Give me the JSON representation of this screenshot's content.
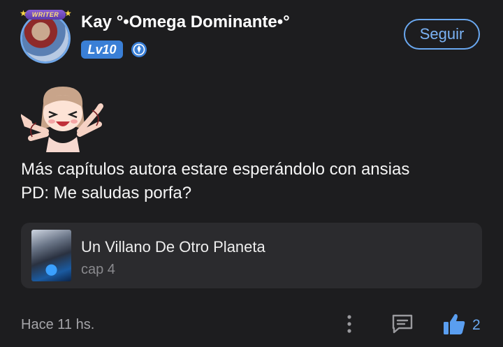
{
  "header": {
    "avatar_badge": "WRITER",
    "username": "Kay °•Omega Dominante•°",
    "level": "Lv10",
    "follow_label": "Seguir"
  },
  "comment": {
    "lines": [
      "Más capítulos autora estare esperándolo con ansias",
      "PD: Me saludas porfa?"
    ]
  },
  "chapter_card": {
    "work_title": "Un Villano De Otro Planeta",
    "chapter": "cap 4"
  },
  "footer": {
    "timestamp": "Hace 11 hs.",
    "likes": "2"
  },
  "icons": {
    "verified": "verified-badge-icon",
    "more": "more-vertical-icon",
    "comment": "comment-bubble-icon",
    "like": "thumbs-up-icon"
  },
  "colors": {
    "background": "#1d1d1f",
    "accent": "#6aa8f0",
    "level_badge": "#3a7fd6",
    "card": "#2b2b2e",
    "muted_text": "#a5a5a9"
  }
}
